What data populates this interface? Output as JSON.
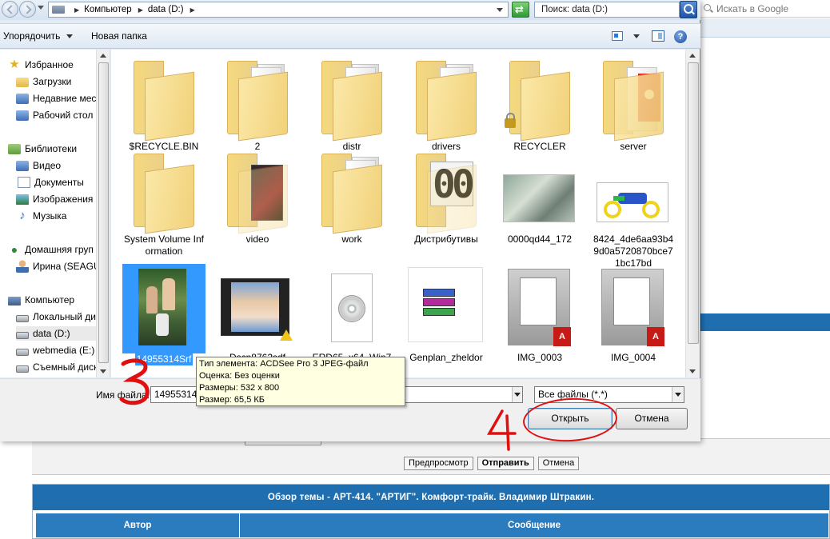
{
  "background": {
    "google_search_placeholder": "Искать в Google",
    "buttons": [
      "Предпросмотр",
      "Отправить",
      "Отмена"
    ],
    "topic_title": "Обзор темы - АРТ-414. \"АРТИГ\". Комфорт-трайк. Владимир Штракин.",
    "table_headers": [
      "Автор",
      "Сообщение"
    ]
  },
  "dialog": {
    "address": {
      "crumbs": [
        "Компьютер",
        "data (D:)"
      ]
    },
    "search": {
      "placeholder": "Поиск: data (D:)"
    },
    "toolbar": {
      "organize": "Упорядочить",
      "new_folder": "Новая папка"
    },
    "nav": [
      {
        "label": "Избранное",
        "icon": "star-icon",
        "level": 0
      },
      {
        "label": "Загрузки",
        "icon": "downloads-folder-icon",
        "level": 1
      },
      {
        "label": "Недавние мест",
        "icon": "recent-places-icon",
        "level": 1
      },
      {
        "label": "Рабочий стол",
        "icon": "desktop-icon",
        "level": 1
      },
      {
        "label": "Библиотеки",
        "icon": "libraries-icon",
        "level": 0
      },
      {
        "label": "Видео",
        "icon": "video-library-icon",
        "level": 1
      },
      {
        "label": "Документы",
        "icon": "documents-library-icon",
        "level": 1
      },
      {
        "label": "Изображения",
        "icon": "pictures-library-icon",
        "level": 1
      },
      {
        "label": "Музыка",
        "icon": "music-library-icon",
        "level": 1
      },
      {
        "label": "Домашняя груп",
        "icon": "homegroup-icon",
        "level": 0
      },
      {
        "label": "Ирина (SEAGU",
        "icon": "user-icon",
        "level": 1
      },
      {
        "label": "Компьютер",
        "icon": "computer-icon",
        "level": 0
      },
      {
        "label": "Локальный ди",
        "icon": "local-disk-icon",
        "level": 1
      },
      {
        "label": "data (D:)",
        "icon": "drive-icon",
        "level": 1,
        "selected": true
      },
      {
        "label": "webmedia (E:)",
        "icon": "drive-icon",
        "level": 1
      },
      {
        "label": "Съемный диск",
        "icon": "removable-drive-icon",
        "level": 1
      }
    ],
    "files": [
      {
        "name": "$RECYCLE.BIN",
        "kind": "folder"
      },
      {
        "name": "2",
        "kind": "folder-docs"
      },
      {
        "name": "distr",
        "kind": "folder-docs"
      },
      {
        "name": "drivers",
        "kind": "folder-docs"
      },
      {
        "name": "RECYCLER",
        "kind": "folder-locked"
      },
      {
        "name": "server",
        "kind": "folder-flag"
      },
      {
        "name": "System Volume Information",
        "kind": "folder"
      },
      {
        "name": "video",
        "kind": "folder-dark"
      },
      {
        "name": "work",
        "kind": "folder-docs"
      },
      {
        "name": "Дистрибутивы",
        "kind": "folder-digits"
      },
      {
        "name": "0000qd44_172",
        "kind": "photo-room"
      },
      {
        "name": "8424_4de6aa93b49d0a5720870bce71bc17bd",
        "kind": "photo-bike"
      },
      {
        "name": "14955314Srf",
        "kind": "photo-people",
        "selected": true
      },
      {
        "name": "Dscn8762sdf",
        "kind": "photo-film"
      },
      {
        "name": "ERD65_x64_Win7_...ce",
        "kind": "iso"
      },
      {
        "name": "Genplan_zheldor",
        "kind": "rar"
      },
      {
        "name": "IMG_0003",
        "kind": "pdf"
      },
      {
        "name": "IMG_0004",
        "kind": "pdf"
      }
    ],
    "tooltip": [
      "Тип элемента: ACDSee Pro 3 JPEG-файл",
      "Оценка: Без оценки",
      "Размеры: 532 x 800",
      "Размер: 65,5 КБ"
    ],
    "filename_label": "Имя файла:",
    "filename_value": "14955314",
    "filter_value": "Все файлы (*.*)",
    "open_button": "Открыть",
    "cancel_button": "Отмена"
  },
  "annotations": {
    "step3": "3",
    "step4": "4",
    "color": "#e01010"
  }
}
